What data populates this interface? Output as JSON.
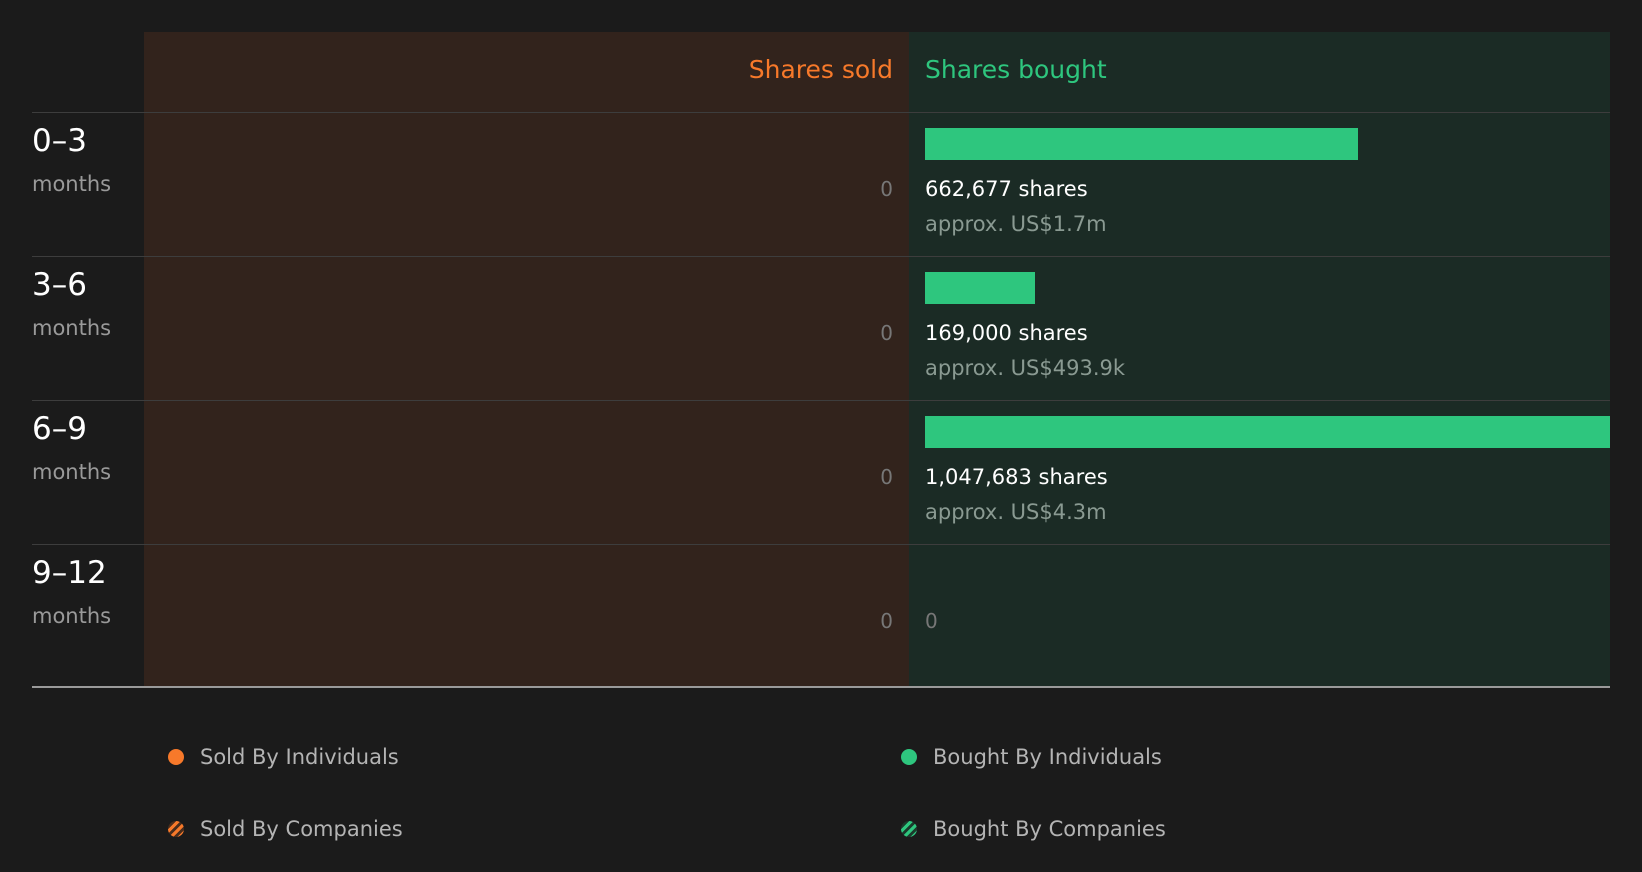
{
  "chart_data": {
    "type": "bar",
    "headers": {
      "sold": "Shares sold",
      "bought": "Shares bought"
    },
    "categories": [
      {
        "period": "0–3",
        "unit": "months"
      },
      {
        "period": "3–6",
        "unit": "months"
      },
      {
        "period": "6–9",
        "unit": "months"
      },
      {
        "period": "9–12",
        "unit": "months"
      }
    ],
    "sold": [
      {
        "value": 0,
        "label": "0"
      },
      {
        "value": 0,
        "label": "0"
      },
      {
        "value": 0,
        "label": "0"
      },
      {
        "value": 0,
        "label": "0"
      }
    ],
    "bought": [
      {
        "value": 662677,
        "shares_label": "662,677 shares",
        "approx_label": "approx. US$1.7m"
      },
      {
        "value": 169000,
        "shares_label": "169,000 shares",
        "approx_label": "approx. US$493.9k"
      },
      {
        "value": 1047683,
        "shares_label": "1,047,683 shares",
        "approx_label": "approx. US$4.3m"
      },
      {
        "value": 0,
        "zero_label": "0"
      }
    ],
    "legend": [
      {
        "label": "Sold By Individuals",
        "color": "#f7792a",
        "style": "solid"
      },
      {
        "label": "Bought By Individuals",
        "color": "#2ec67e",
        "style": "solid"
      },
      {
        "label": "Sold By Companies",
        "color": "#f7792a",
        "style": "hatched"
      },
      {
        "label": "Bought By Companies",
        "color": "#2ec67e",
        "style": "hatched"
      }
    ],
    "colors": {
      "sold": "#f7792a",
      "bought": "#2ec67e"
    }
  }
}
